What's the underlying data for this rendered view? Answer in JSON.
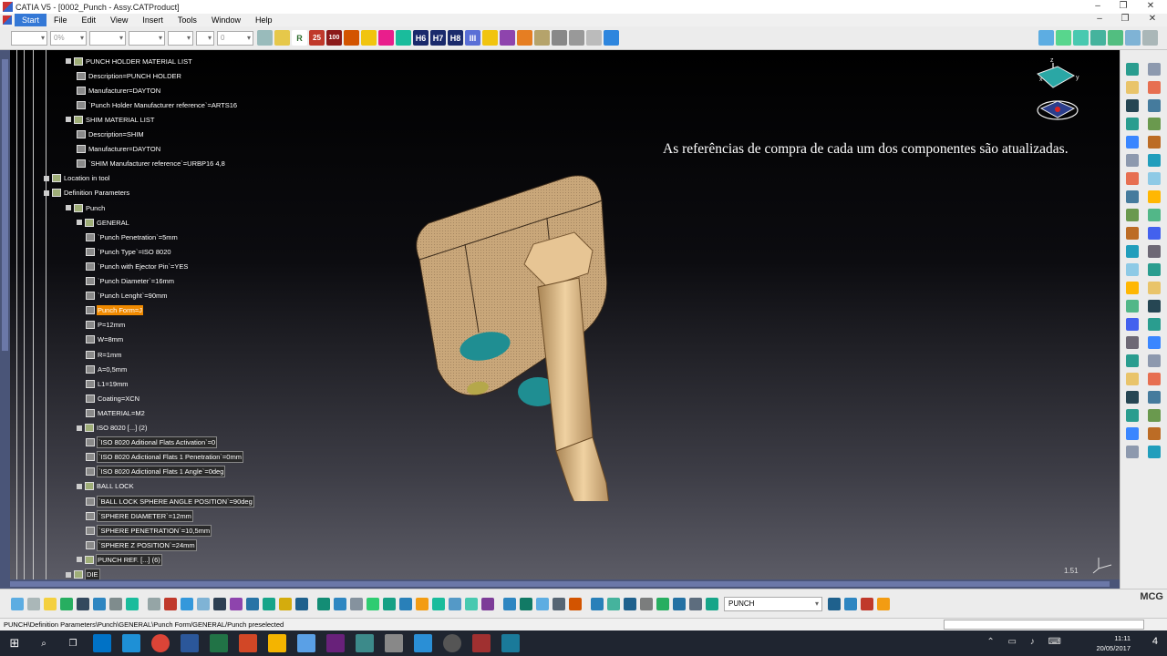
{
  "window": {
    "title": "CATIA V5 - [0002_Punch - Assy.CATProduct]",
    "controls": [
      "–",
      "❐",
      "✕"
    ]
  },
  "menu": {
    "items": [
      {
        "label": "Start",
        "active": true
      },
      {
        "label": "File"
      },
      {
        "label": "Edit"
      },
      {
        "label": "View"
      },
      {
        "label": "Insert"
      },
      {
        "label": "Tools"
      },
      {
        "label": "Window"
      },
      {
        "label": "Help"
      }
    ],
    "doc_controls": [
      "–",
      "❐",
      "✕"
    ]
  },
  "toolbar_top": {
    "percent_value": "0%",
    "layer_value": "0",
    "icon_glyphs": [
      "R",
      "25",
      "100",
      "",
      "",
      "",
      "",
      "H6",
      "H7",
      "H8",
      "III",
      "",
      "",
      "",
      "",
      ""
    ]
  },
  "caption": "As referências de compra de cada um dos componentes são atualizadas.",
  "tree": [
    {
      "label": "PUNCH HOLDER MATERIAL LIST",
      "level": 1,
      "type": "folder"
    },
    {
      "label": "Description=PUNCH HOLDER",
      "level": 2,
      "type": "param"
    },
    {
      "label": "Manufacturer=DAYTON",
      "level": 2,
      "type": "param"
    },
    {
      "label": "`Punch Holder Manufacturer reference`=ARTS16",
      "level": 2,
      "type": "param"
    },
    {
      "label": "SHIM MATERIAL LIST",
      "level": 1,
      "type": "folder"
    },
    {
      "label": "Description=SHIM",
      "level": 2,
      "type": "param"
    },
    {
      "label": "Manufacturer=DAYTON",
      "level": 2,
      "type": "param"
    },
    {
      "label": "`SHIM Manufacturer reference`=URBP16 4,8",
      "level": 2,
      "type": "param"
    },
    {
      "label": "Location in tool",
      "level": 0,
      "type": "folder"
    },
    {
      "label": "Definition Parameters",
      "level": 0,
      "type": "folder"
    },
    {
      "label": "Punch",
      "level": 1,
      "type": "folder"
    },
    {
      "label": "GENERAL",
      "level": 2,
      "type": "folder"
    },
    {
      "label": "`Punch Penetration`=5mm",
      "level": 3,
      "type": "param"
    },
    {
      "label": "`Punch Type`=ISO 8020",
      "level": 3,
      "type": "param"
    },
    {
      "label": "`Punch with Ejector Pin`=YES",
      "level": 3,
      "type": "param"
    },
    {
      "label": "`Punch Diameter`=16mm",
      "level": 3,
      "type": "param"
    },
    {
      "label": "`Punch Lenght`=90mm",
      "level": 3,
      "type": "param"
    },
    {
      "label": "Punch Form=J",
      "level": 3,
      "type": "param",
      "state": "selected"
    },
    {
      "label": "P=12mm",
      "level": 3,
      "type": "param"
    },
    {
      "label": "W=8mm",
      "level": 3,
      "type": "param"
    },
    {
      "label": "R=1mm",
      "level": 3,
      "type": "param"
    },
    {
      "label": "A=0,5mm",
      "level": 3,
      "type": "param"
    },
    {
      "label": "L1=19mm",
      "level": 3,
      "type": "param"
    },
    {
      "label": "Coating=XCN",
      "level": 3,
      "type": "param"
    },
    {
      "label": "MATERIAL=M2",
      "level": 3,
      "type": "param"
    },
    {
      "label": "ISO 8020 [...] (2)",
      "level": 2,
      "type": "folder"
    },
    {
      "label": "`ISO 8020 Aditional Flats Activation`=0",
      "level": 3,
      "type": "param",
      "state": "boxed"
    },
    {
      "label": "`ISO 8020 Adictional Flats 1 Penetration`=0mm",
      "level": 3,
      "type": "param",
      "state": "boxed"
    },
    {
      "label": "`ISO 8020 Adictional Flats 1 Angle`=0deg",
      "level": 3,
      "type": "param",
      "state": "boxed"
    },
    {
      "label": "BALL LOCK",
      "level": 2,
      "type": "folder"
    },
    {
      "label": "`BALL LOCK SPHERE ANGLE POSITION`=90deg",
      "level": 3,
      "type": "param",
      "state": "boxed"
    },
    {
      "label": "`SPHERE DIAMETER`=12mm",
      "level": 3,
      "type": "param",
      "state": "boxed"
    },
    {
      "label": "`SPHERE PENETRATION`=10,5mm",
      "level": 3,
      "type": "param",
      "state": "boxed"
    },
    {
      "label": "`SPHERE Z POSITION`=24mm",
      "level": 3,
      "type": "param",
      "state": "boxed"
    },
    {
      "label": "PUNCH REF. [...] (6)",
      "level": 2,
      "type": "folder",
      "state": "boxed"
    },
    {
      "label": "DIE",
      "level": 1,
      "type": "folder",
      "state": "boxed"
    }
  ],
  "viewport": {
    "scale": "1.51",
    "compass_labels": {
      "z": "z",
      "x": "x",
      "y": "y"
    }
  },
  "toolbar_bottom": {
    "product_select": "PUNCH",
    "brand": "MCG"
  },
  "status": {
    "text": "PUNCH\\Definition Parameters\\Punch\\GENERAL\\Punch Form/GENERAL/Punch preselected"
  },
  "taskbar": {
    "time": "11:11",
    "date": "20/05/2017",
    "notifications": "4"
  },
  "colors": {
    "selected": "#f08a00",
    "tree_text": "#ffffff",
    "part_body": "#c9a77a",
    "hole": "#1f8e92",
    "ui_panel": "#ececec"
  }
}
